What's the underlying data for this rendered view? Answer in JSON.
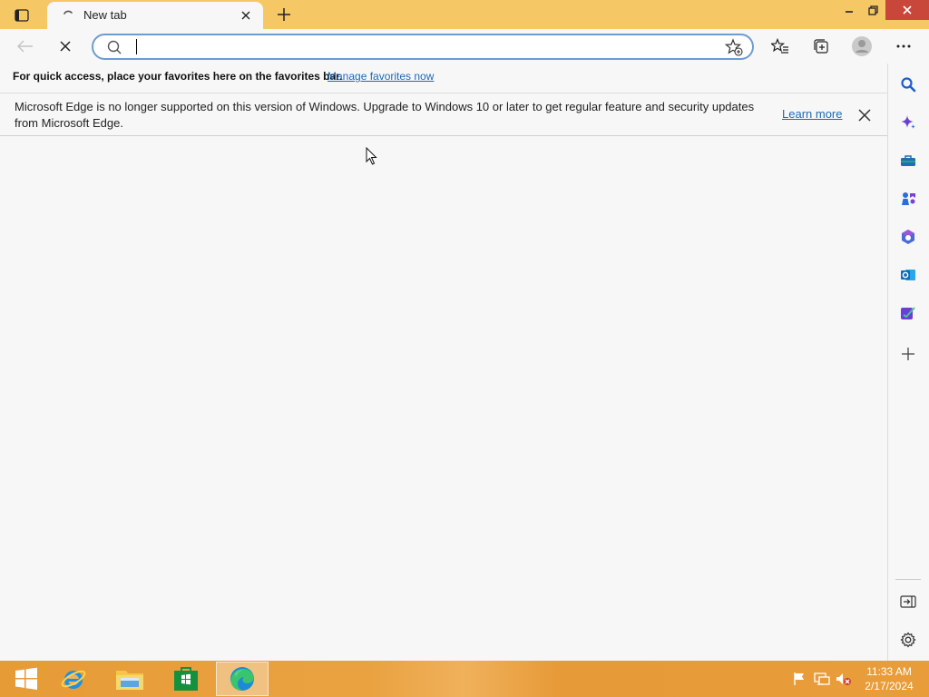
{
  "browser": {
    "tab": {
      "title": "New tab"
    },
    "address": {
      "value": "",
      "placeholder": ""
    },
    "favorites_bar": {
      "hint": "For quick access, place your favorites here on the favorites bar.",
      "manage_link": "Manage favorites now"
    },
    "infobar": {
      "message": "Microsoft Edge is no longer supported on this version of Windows. Upgrade to Windows 10 or later to get regular feature and security updates from Microsoft Edge.",
      "learn_more": "Learn more"
    },
    "sidebar": {
      "items": [
        "search-icon",
        "copilot-icon",
        "shopping-icon",
        "games-icon",
        "microsoft365-icon",
        "outlook-icon",
        "drop-icon",
        "add-icon"
      ],
      "bottom": [
        "hide-sidebar-icon",
        "settings-icon"
      ]
    }
  },
  "taskbar": {
    "apps": [
      "start-icon",
      "internet-explorer-icon",
      "file-explorer-icon",
      "store-icon",
      "edge-icon"
    ],
    "clock": {
      "time": "11:33 AM",
      "date": "2/17/2024"
    }
  },
  "colors": {
    "titlebar": "#f5c865",
    "close_button": "#c8463a",
    "link": "#1a6bb8",
    "taskbar": "#e69b36"
  }
}
